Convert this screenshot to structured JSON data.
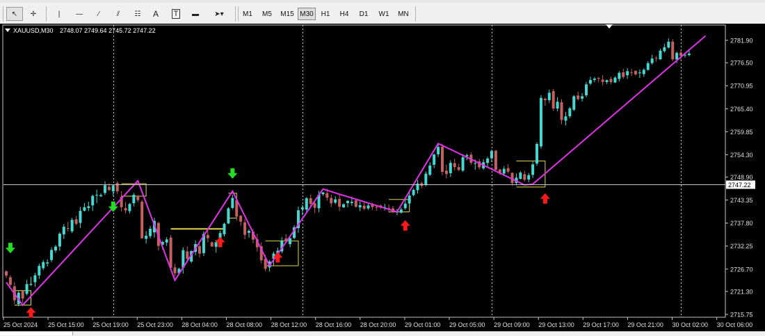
{
  "toolbar": {
    "tools": [
      {
        "name": "cursor-tool-button",
        "icon": "cursor-arrow-icon",
        "glyph": "↖"
      },
      {
        "name": "crosshair-tool-button",
        "icon": "crosshair-icon",
        "glyph": "✛"
      },
      {
        "name": "vertical-line-tool-button",
        "icon": "vertical-line-icon",
        "glyph": "|"
      },
      {
        "name": "horizontal-line-tool-button",
        "icon": "horizontal-line-icon",
        "glyph": "—"
      },
      {
        "name": "trendline-tool-button",
        "icon": "trendline-icon",
        "glyph": "∕"
      },
      {
        "name": "equidistant-channel-tool-button",
        "icon": "channel-icon",
        "glyph": "⫽"
      },
      {
        "name": "fibonacci-tool-button",
        "icon": "fibonacci-icon",
        "glyph": "☷"
      },
      {
        "name": "text-tool-button",
        "icon": "text-icon",
        "glyph": "A"
      },
      {
        "name": "text-label-tool-button",
        "icon": "text-label-icon",
        "glyph": "T"
      },
      {
        "name": "rectangle-tool-button",
        "icon": "rectangle-icon",
        "glyph": "▬"
      },
      {
        "name": "arrows-tool-button",
        "icon": "arrows-dropdown-icon",
        "glyph": "➤▾"
      }
    ],
    "timeframes": [
      "M1",
      "M5",
      "M15",
      "M30",
      "H1",
      "H4",
      "D1",
      "W1",
      "MN"
    ],
    "active_timeframe": "M30"
  },
  "chart_info": {
    "symbol_label": "XAUUSD,M30",
    "ohlc": "2748.07 2749.64 2745.72 2747.22"
  },
  "colors": {
    "background": "#000000",
    "bull": "#45d8d0",
    "bear": "#c46060",
    "zigzag": "#e033e8",
    "buy_arrow": "#ff1a1a",
    "sell_arrow": "#22dd22",
    "level_box": "#e8d84a",
    "price_line": "#c8c8c8",
    "axis_text": "#e0e0e0"
  },
  "chart_data": {
    "type": "candlestick",
    "symbol": "XAUUSD",
    "timeframe": "M30",
    "current_price": 2747.22,
    "current_price_label": "2747.22",
    "ylim": [
      2713.0,
      2785.0
    ],
    "yticks": [
      2781.9,
      2776.5,
      2770.95,
      2765.4,
      2759.85,
      2754.3,
      2748.9,
      2743.35,
      2737.8,
      2732.25,
      2726.7,
      2721.3,
      2715.75
    ],
    "ytick_labels": [
      "2781.90",
      "2776.50",
      "2770.95",
      "2765.40",
      "2759.85",
      "2754.30",
      "2748.90",
      "2743.35",
      "2737.80",
      "2732.25",
      "2726.70",
      "2721.30",
      "2715.75"
    ],
    "x_tick_labels": [
      "25 Oct 2024",
      "25 Oct 15:00",
      "25 Oct 19:00",
      "25 Oct 23:00",
      "28 Oct 04:00",
      "28 Oct 08:00",
      "28 Oct 12:00",
      "28 Oct 16:00",
      "28 Oct 20:00",
      "29 Oct 01:00",
      "29 Oct 05:00",
      "29 Oct 09:00",
      "29 Oct 13:00",
      "29 Oct 17:00",
      "29 Oct 21:00",
      "30 Oct 02:00",
      "30 Oct 06:00"
    ],
    "session_separators_at_bar": [
      26,
      72,
      118,
      164
    ],
    "zigzag": [
      [
        0,
        2723.5
      ],
      [
        4,
        2718.0
      ],
      [
        32,
        2748.0
      ],
      [
        41,
        2724.0
      ],
      [
        55,
        2745.5
      ],
      [
        64,
        2727.5
      ],
      [
        77,
        2746.0
      ],
      [
        95,
        2740.5
      ],
      [
        105,
        2757.0
      ],
      [
        126,
        2747.0
      ],
      [
        128,
        2747.2
      ],
      [
        170,
        2783.0
      ]
    ],
    "buy_arrows": [
      [
        6,
        2717.5
      ],
      [
        52,
        2734.5
      ],
      [
        66,
        2730.8
      ],
      [
        97,
        2738.5
      ],
      [
        131,
        2745.0
      ]
    ],
    "sell_arrows": [
      [
        1,
        2730.5
      ],
      [
        26,
        2740.5
      ],
      [
        55,
        2748.5
      ]
    ],
    "level_boxes": [
      {
        "x0": 2,
        "x1": 6,
        "high": 2721.5,
        "low": 2718.0
      },
      {
        "x0": 28,
        "x1": 34,
        "high": 2747.3,
        "low": 2744.3
      },
      {
        "x0": 40,
        "x1": 53,
        "high": 2736.5,
        "low": 2736.3
      },
      {
        "x0": 54,
        "x1": 56,
        "high": 2745.0,
        "low": 2739.0
      },
      {
        "x0": 63,
        "x1": 71,
        "high": 2733.5,
        "low": 2727.5
      },
      {
        "x0": 93,
        "x1": 98,
        "high": 2743.5,
        "low": 2740.5
      },
      {
        "x0": 124,
        "x1": 131,
        "high": 2752.8,
        "low": 2746.5
      }
    ],
    "candles": [
      [
        2726.17,
        2725.11,
        2726.42,
        2724.58
      ],
      [
        2724.71,
        2722.88,
        2725.21,
        2722.54
      ],
      [
        2722.55,
        2719.17,
        2723.48,
        2718.25
      ],
      [
        2718.25,
        2720.99,
        2721.56,
        2717.69
      ],
      [
        2721.44,
        2719.58,
        2721.66,
        2718.55
      ],
      [
        2720.71,
        2723.07,
        2724.11,
        2720.34
      ],
      [
        2722.91,
        2723.13,
        2724.84,
        2722.64
      ],
      [
        2723.52,
        2725.2,
        2725.83,
        2722.4
      ],
      [
        2725.17,
        2727.47,
        2728.03,
        2724.35
      ],
      [
        2726.91,
        2728.38,
        2728.89,
        2726.46
      ],
      [
        2728.05,
        2728.31,
        2729.04,
        2727.32
      ],
      [
        2728.88,
        2731.3,
        2731.93,
        2728.36
      ],
      [
        2731.2,
        2732.12,
        2732.53,
        2730.62
      ],
      [
        2732.14,
        2735.24,
        2735.62,
        2731.11
      ],
      [
        2735.09,
        2736.92,
        2737.55,
        2733.97
      ],
      [
        2736.57,
        2736.4,
        2738.13,
        2735.78
      ],
      [
        2735.81,
        2738.57,
        2739.08,
        2735.39
      ],
      [
        2738.72,
        2737.62,
        2739.54,
        2737.27
      ],
      [
        2737.83,
        2740.74,
        2741.68,
        2736.62
      ],
      [
        2740.79,
        2741.62,
        2742.62,
        2740.6
      ],
      [
        2741.42,
        2741.84,
        2742.94,
        2740.69
      ],
      [
        2742.07,
        2744.37,
        2744.7,
        2740.73
      ],
      [
        2744.51,
        2744.64,
        2745.86,
        2742.65
      ],
      [
        2744.28,
        2744.54,
        2745.0,
        2744.09
      ],
      [
        2745.05,
        2746.92,
        2747.9,
        2744.55
      ],
      [
        2746.55,
        2745.8,
        2747.44,
        2745.51
      ],
      [
        2745.46,
        2746.87,
        2747.12,
        2744.31
      ],
      [
        2747.47,
        2745.47,
        2747.87,
        2744.82
      ],
      [
        2744.16,
        2741.63,
        2745.5,
        2740.59
      ],
      [
        2741.41,
        2740.86,
        2742.92,
        2740.13
      ],
      [
        2740.68,
        2742.41,
        2742.63,
        2740.12
      ],
      [
        2742.6,
        2744.62,
        2745.08,
        2741.82
      ],
      [
        2744.32,
        2743.34,
        2744.56,
        2742.83
      ],
      [
        2742.95,
        2734.13,
        2743.36,
        2734.05
      ],
      [
        2734.0,
        2734.76,
        2735.86,
        2732.86
      ],
      [
        2734.64,
        2736.43,
        2737.15,
        2734.07
      ],
      [
        2735.55,
        2738.32,
        2739.04,
        2734.31
      ],
      [
        2737.82,
        2732.28,
        2738.12,
        2731.21
      ],
      [
        2732.6,
        2733.24,
        2733.51,
        2731.39
      ],
      [
        2733.1,
        2733.85,
        2734.41,
        2732.28
      ],
      [
        2734.31,
        2727.01,
        2734.93,
        2726.69
      ],
      [
        2727.09,
        2725.7,
        2727.96,
        2724.92
      ],
      [
        2725.7,
        2726.77,
        2727.03,
        2725.31
      ],
      [
        2727.03,
        2731.27,
        2731.97,
        2725.62
      ],
      [
        2730.97,
        2729.16,
        2732.17,
        2728.35
      ],
      [
        2728.52,
        2731.04,
        2731.26,
        2728.12
      ],
      [
        2730.84,
        2732.72,
        2733.62,
        2730.0
      ],
      [
        2732.2,
        2730.43,
        2732.73,
        2729.48
      ],
      [
        2730.55,
        2735.16,
        2735.84,
        2729.83
      ],
      [
        2734.94,
        2734.14,
        2735.95,
        2733.17
      ],
      [
        2733.16,
        2732.15,
        2733.37,
        2732.07
      ],
      [
        2732.07,
        2733.2,
        2733.73,
        2730.68
      ],
      [
        2733.43,
        2735.38,
        2735.97,
        2732.87
      ],
      [
        2735.11,
        2737.63,
        2737.92,
        2734.53
      ],
      [
        2737.7,
        2741.36,
        2741.65,
        2737.57
      ],
      [
        2741.44,
        2743.85,
        2744.68,
        2741.17
      ],
      [
        2743.34,
        2739.37,
        2743.59,
        2738.4
      ],
      [
        2739.56,
        2738.15,
        2739.78,
        2737.12
      ],
      [
        2737.97,
        2734.96,
        2738.82,
        2733.84
      ],
      [
        2735.46,
        2735.92,
        2736.34,
        2734.26
      ],
      [
        2735.71,
        2733.81,
        2736.33,
        2732.98
      ],
      [
        2733.89,
        2731.94,
        2735.21,
        2730.91
      ],
      [
        2732.21,
        2728.81,
        2733.15,
        2728.04
      ],
      [
        2729.18,
        2726.77,
        2730.13,
        2726.13
      ],
      [
        2727.08,
        2728.54,
        2728.88,
        2726.12
      ],
      [
        2729.18,
        2730.45,
        2730.91,
        2727.62
      ],
      [
        2730.27,
        2731.13,
        2731.88,
        2730.04
      ],
      [
        2730.96,
        2733.48,
        2734.41,
        2730.54
      ],
      [
        2734.08,
        2733.48,
        2735.12,
        2733.24
      ],
      [
        2732.72,
        2734.11,
        2734.34,
        2731.98
      ],
      [
        2734.2,
        2736.77,
        2737.3,
        2733.89
      ],
      [
        2736.58,
        2740.89,
        2741.76,
        2735.43
      ],
      [
        2741.1,
        2741.58,
        2742.27,
        2739.66
      ],
      [
        2741.04,
        2743.82,
        2744.07,
        2740.51
      ],
      [
        2743.81,
        2742.44,
        2744.74,
        2741.91
      ],
      [
        2742.56,
        2741.49,
        2743.05,
        2740.25
      ],
      [
        2741.38,
        2744.65,
        2745.56,
        2740.39
      ],
      [
        2744.77,
        2745.2,
        2745.34,
        2744.4
      ],
      [
        2745.01,
        2743.92,
        2746.08,
        2743.18
      ],
      [
        2743.86,
        2742.57,
        2744.64,
        2741.68
      ],
      [
        2742.72,
        2743.52,
        2744.25,
        2742.34
      ],
      [
        2743.63,
        2741.74,
        2744.66,
        2740.71
      ],
      [
        2741.61,
        2742.35,
        2742.55,
        2741.43
      ],
      [
        2742.61,
        2743.15,
        2743.36,
        2741.62
      ],
      [
        2742.63,
        2742.93,
        2744.19,
        2741.97
      ],
      [
        2743.29,
        2741.73,
        2743.59,
        2741.51
      ],
      [
        2741.59,
        2742.1,
        2743.0,
        2740.69
      ],
      [
        2742.01,
        2741.27,
        2742.72,
        2740.9
      ],
      [
        2741.34,
        2742.05,
        2742.5,
        2741.03
      ],
      [
        2742.23,
        2741.65,
        2742.65,
        2741.0
      ],
      [
        2741.73,
        2741.52,
        2742.09,
        2740.76
      ],
      [
        2742.03,
        2741.58,
        2742.3,
        2741.18
      ],
      [
        2741.65,
        2741.66,
        2742.42,
        2740.83
      ],
      [
        2741.39,
        2741.21,
        2742.28,
        2740.33
      ],
      [
        2741.35,
        2740.43,
        2741.96,
        2740.21
      ],
      [
        2740.35,
        2740.51,
        2741.2,
        2739.69
      ],
      [
        2740.31,
        2741.08,
        2741.55,
        2740.09
      ],
      [
        2741.39,
        2742.49,
        2743.43,
        2741.01
      ],
      [
        2742.53,
        2744.44,
        2745.25,
        2741.79
      ],
      [
        2744.54,
        2745.8,
        2746.16,
        2744.24
      ],
      [
        2745.73,
        2747.33,
        2748.19,
        2744.91
      ],
      [
        2747.44,
        2746.8,
        2747.84,
        2746.23
      ],
      [
        2747.05,
        2749.72,
        2750.24,
        2746.66
      ],
      [
        2749.45,
        2751.7,
        2752.48,
        2749.15
      ],
      [
        2751.87,
        2754.35,
        2754.54,
        2751.06
      ],
      [
        2754.41,
        2756.16,
        2756.82,
        2753.76
      ],
      [
        2756.21,
        2750.17,
        2756.91,
        2749.35
      ],
      [
        2750.47,
        2749.64,
        2751.89,
        2748.58
      ],
      [
        2749.85,
        2752.32,
        2752.94,
        2748.94
      ],
      [
        2752.27,
        2751.31,
        2753.33,
        2750.47
      ],
      [
        2751.3,
        2750.63,
        2752.19,
        2750.3
      ],
      [
        2750.47,
        2753.68,
        2754.42,
        2750.16
      ],
      [
        2753.92,
        2754.17,
        2754.52,
        2752.97
      ],
      [
        2754.31,
        2752.37,
        2754.82,
        2751.88
      ],
      [
        2752.14,
        2752.27,
        2753.17,
        2750.65
      ],
      [
        2752.7,
        2751.25,
        2753.3,
        2750.72
      ],
      [
        2751.01,
        2752.48,
        2753.21,
        2750.64
      ],
      [
        2752.31,
        2753.38,
        2753.81,
        2751.36
      ],
      [
        2753.43,
        2755.18,
        2755.55,
        2752.52
      ],
      [
        2755.27,
        2750.65,
        2755.44,
        2750.54
      ],
      [
        2750.73,
        2749.8,
        2750.91,
        2749.39
      ],
      [
        2749.75,
        2750.9,
        2751.51,
        2749.15
      ],
      [
        2751.06,
        2750.2,
        2752.0,
        2749.78
      ],
      [
        2749.92,
        2747.44,
        2750.03,
        2746.9
      ],
      [
        2747.47,
        2748.77,
        2749.72,
        2746.88
      ],
      [
        2748.47,
        2749.98,
        2750.35,
        2748.33
      ],
      [
        2749.59,
        2748.24,
        2750.45,
        2747.84
      ],
      [
        2748.31,
        2749.37,
        2749.92,
        2747.6
      ],
      [
        2749.43,
        2751.96,
        2752.63,
        2748.69
      ],
      [
        2752.18,
        2756.89,
        2757.27,
        2751.61
      ],
      [
        2756.3,
        2768.01,
        2768.68,
        2755.75
      ],
      [
        2767.79,
        2767.45,
        2768.13,
        2766.07
      ],
      [
        2767.46,
        2769.25,
        2770.05,
        2766.82
      ],
      [
        2769.67,
        2765.45,
        2770.19,
        2764.9
      ],
      [
        2765.44,
        2767.08,
        2768.18,
        2764.73
      ],
      [
        2766.95,
        2762.67,
        2767.71,
        2761.65
      ],
      [
        2762.52,
        2763.54,
        2764.63,
        2761.34
      ],
      [
        2763.59,
        2765.49,
        2765.86,
        2763.19
      ],
      [
        2765.16,
        2768.41,
        2768.67,
        2764.83
      ],
      [
        2768.59,
        2767.73,
        2769.51,
        2767.39
      ],
      [
        2767.82,
        2768.41,
        2769.17,
        2767.13
      ],
      [
        2768.64,
        2771.29,
        2771.81,
        2768.15
      ],
      [
        2771.47,
        2772.34,
        2773.11,
        2771.07
      ],
      [
        2772.35,
        2772.66,
        2773.06,
        2771.82
      ],
      [
        2772.82,
        2772.64,
        2773.09,
        2771.76
      ],
      [
        2772.42,
        2771.86,
        2773.51,
        2771.05
      ],
      [
        2771.85,
        2772.29,
        2772.4,
        2771.34
      ],
      [
        2772.57,
        2771.84,
        2773.11,
        2771.36
      ],
      [
        2771.73,
        2772.91,
        2773.19,
        2771.59
      ],
      [
        2772.59,
        2774.07,
        2774.47,
        2771.95
      ],
      [
        2774.17,
        2773.06,
        2775.01,
        2772.63
      ],
      [
        2773.48,
        2774.46,
        2775.19,
        2772.6
      ],
      [
        2774.22,
        2774.05,
        2775.05,
        2773.26
      ],
      [
        2774.56,
        2773.7,
        2774.61,
        2773.45
      ],
      [
        2774.09,
        2774.15,
        2774.91,
        2772.82
      ],
      [
        2773.76,
        2774.79,
        2775.18,
        2773.1
      ],
      [
        2774.78,
        2776.39,
        2776.89,
        2774.57
      ],
      [
        2776.4,
        2777.51,
        2778.41,
        2776.01
      ],
      [
        2777.66,
        2777.5,
        2778.12,
        2776.73
      ],
      [
        2777.33,
        2779.41,
        2779.91,
        2777.24
      ],
      [
        2779.3,
        2780.24,
        2781.04,
        2778.96
      ],
      [
        2780.16,
        2781.57,
        2782.38,
        2779.92
      ],
      [
        2781.59,
        2777.32,
        2782.2,
        2776.88
      ],
      [
        2777.29,
        2778.86,
        2779.22,
        2776.39
      ],
      [
        2778.94,
        2778.17,
        2779.69,
        2776.96
      ],
      [
        2778.37,
        2778.42,
        2778.91,
        2777.75
      ],
      [
        2778.36,
        2778.7,
        2779.83,
        2778.05
      ]
    ]
  }
}
